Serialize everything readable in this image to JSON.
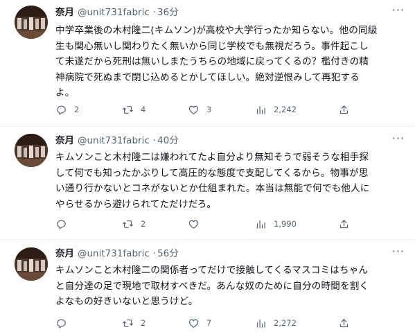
{
  "tweets": [
    {
      "name": "奈月",
      "handle": "@unit731fabric",
      "time": "36分",
      "lines": [
        "中学卒業後の木村隆二(キムソン)が高校や大学行ったか知らない。他の同級",
        "生も関心無いし関わりたく無いから同じ学校でも無視だろう。事件起こし",
        "て未遂だから死刑は無いしまたうちらの地域に戻ってくるの？檻付きの精",
        "神病院で死ぬまで閉じ込めるとかしてほしい。絶対逆恨みして再犯する",
        "よ。"
      ],
      "replies": "2",
      "retweets": "4",
      "likes": "3",
      "views": "2,242"
    },
    {
      "name": "奈月",
      "handle": "@unit731fabric",
      "time": "40分",
      "lines": [
        "キムソンこと木村隆二は嫌われてたよ自分より無知そうで弱そうな相手探",
        "して何でも知ったかぶりして高圧的な態度で支配してくるから。物事が思",
        "い通り行かないとコネがないとか仕組まれた。本当は無能で何でも他人に",
        "やらせるから避けられてただけだろ。"
      ],
      "replies": "",
      "retweets": "2",
      "likes": "",
      "views": "1,990"
    },
    {
      "name": "奈月",
      "handle": "@unit731fabric",
      "time": "56分",
      "lines": [
        "キムソンこと木村隆二の関係者ってだけで接触してくるマスコミはちゃん",
        "と自分達の足で現地で取材すべきだ。あんな奴のために自分の時間を割く",
        "よなもの好きいないと思うけど。"
      ],
      "replies": "",
      "retweets": "2",
      "likes": "7",
      "views": "2,272"
    }
  ],
  "icons": {
    "reply": "reply-icon",
    "retweet": "retweet-icon",
    "like": "heart-icon",
    "views": "views-icon",
    "share": "share-icon",
    "more": "more-icon"
  },
  "colors": {
    "text": "#0f1419",
    "secondary": "#536471",
    "divider": "#eff3f4"
  }
}
